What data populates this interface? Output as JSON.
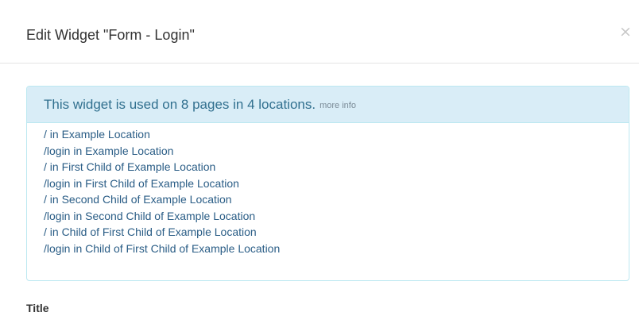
{
  "modal": {
    "title": "Edit Widget \"Form - Login\"",
    "close_label": "×"
  },
  "usage": {
    "summary": "This widget is used on 8 pages in 4 locations.",
    "more_info": "more info",
    "locations": [
      "/ in Example Location",
      "/login in Example Location",
      "/ in First Child of Example Location",
      "/login in First Child of Example Location",
      "/ in Second Child of Example Location",
      "/login in Second Child of Example Location",
      "/ in Child of First Child of Example Location",
      "/login in Child of First Child of Example Location"
    ]
  },
  "form": {
    "title_label": "Title"
  },
  "colors": {
    "panel_heading_bg": "#d9edf7",
    "panel_border": "#bce8f1",
    "heading_text": "#31708f",
    "link": "#2a5d86"
  }
}
